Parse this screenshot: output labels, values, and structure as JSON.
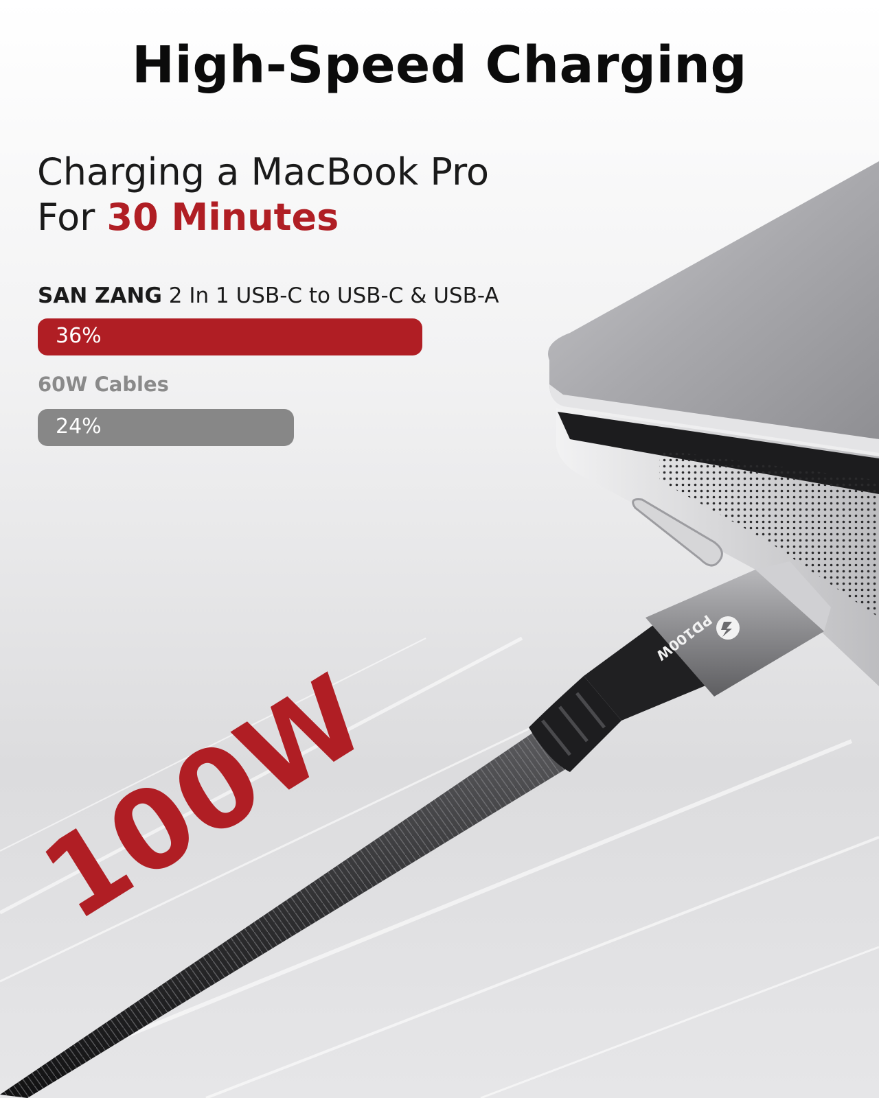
{
  "headline": "High-Speed Charging",
  "subtitle": {
    "line1": "Charging a MacBook Pro",
    "line2_prefix": "For ",
    "line2_highlight": "30 Minutes"
  },
  "connector_marking": "PD100W",
  "big_wattage": "100W",
  "colors": {
    "accent_red": "#b01e24",
    "bar_gray": "#878787"
  },
  "chart_data": {
    "type": "bar",
    "orientation": "horizontal",
    "unit": "%",
    "series": [
      {
        "brand": "SAN ZANG",
        "name": "2 In 1 USB-C to USB-C & USB-A",
        "value": 36,
        "value_label": "36%",
        "color": "#b01e24"
      },
      {
        "brand": "",
        "name": "60W Cables",
        "value": 24,
        "value_label": "24%",
        "color": "#878787"
      }
    ],
    "xlim": [
      0,
      36
    ]
  }
}
